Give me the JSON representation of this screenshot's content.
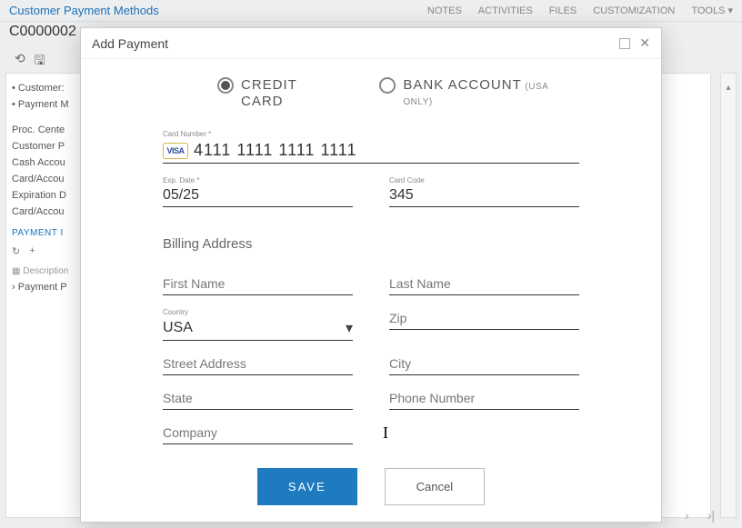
{
  "header": {
    "title": "Customer Payment Methods",
    "notes": "NOTES",
    "activities": "ACTIVITIES",
    "files": "FILES",
    "customization": "CUSTOMIZATION",
    "tools": "TOOLS ▾",
    "customer_id": "C0000002"
  },
  "left": {
    "customer": "• Customer:",
    "payment_m": "• Payment M",
    "proc": "Proc. Cente",
    "cust_p": "Customer P",
    "cash": "Cash Accou",
    "card_a": "Card/Accou",
    "exp": "Expiration D",
    "card_a2": "Card/Accou",
    "tab_payment": "PAYMENT I",
    "desc_label": "Description",
    "grid_row": "Payment P"
  },
  "modal": {
    "title": "Add Payment",
    "radio_credit": "CREDIT CARD",
    "radio_bank": "BANK ACCOUNT",
    "radio_bank_sub": "(USA ONLY)",
    "card_number_label": "Card Number *",
    "card_number_value": "4111 1111 1111 1111",
    "visa": "VISA",
    "exp_label": "Exp. Date *",
    "exp_value": "05/25",
    "code_label": "Card Code",
    "code_value": "345",
    "billing_title": "Billing Address",
    "first_name": "First Name",
    "last_name": "Last Name",
    "country_label": "Country",
    "country_value": "USA",
    "zip": "Zip",
    "street": "Street Address",
    "city": "City",
    "state": "State",
    "phone": "Phone Number",
    "company": "Company",
    "save": "SAVE",
    "cancel": "Cancel"
  }
}
